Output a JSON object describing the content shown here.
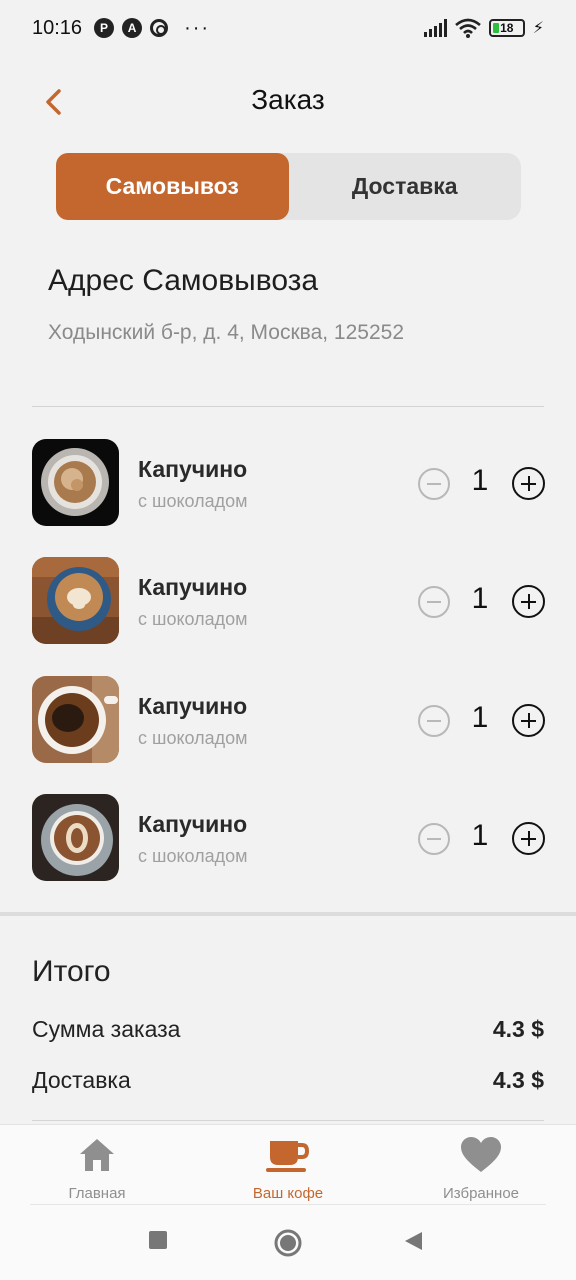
{
  "status_bar": {
    "time": "10:16",
    "icons": [
      "p-app-icon",
      "a-app-icon",
      "spiral-icon",
      "more-dots-icon"
    ],
    "dots": "···",
    "battery_level": "18",
    "right_icons": [
      "signal-icon",
      "wifi-icon",
      "battery-icon",
      "charging-icon"
    ]
  },
  "header": {
    "title": "Заказ",
    "back_icon": "chevron-left-icon"
  },
  "tabs": [
    {
      "label": "Самовывоз",
      "active": true
    },
    {
      "label": "Доставка",
      "active": false
    }
  ],
  "pickup": {
    "title": "Адрес Самовывоза",
    "address": "Ходынский б-р, д. 4, Москва, 125252"
  },
  "items": [
    {
      "name": "Капучино",
      "subtitle": "с шоколадом",
      "quantity": "1",
      "image": "coffee-cup-top-view-black-bg"
    },
    {
      "name": "Капучино",
      "subtitle": "с шоколадом",
      "quantity": "1",
      "image": "latte-art-blue-cup"
    },
    {
      "name": "Капучино",
      "subtitle": "с шоколадом",
      "quantity": "1",
      "image": "coffee-white-cup"
    },
    {
      "name": "Капучино",
      "subtitle": "с шоколадом",
      "quantity": "1",
      "image": "latte-art-dark"
    }
  ],
  "totals": {
    "title": "Итого",
    "rows": [
      {
        "label": "Сумма заказа",
        "value": "4.3 $"
      },
      {
        "label": "Доставка",
        "value": "4.3 $"
      }
    ]
  },
  "bottom_nav": [
    {
      "label": "Главная",
      "icon": "home-icon",
      "active": false
    },
    {
      "label": "Ваш кофе",
      "icon": "coffee-cup-icon",
      "active": true
    },
    {
      "label": "Избранное",
      "icon": "heart-icon",
      "active": false
    }
  ],
  "colors": {
    "accent": "#c4672f",
    "background": "#f2f2f2",
    "muted_text": "#8a8a8a"
  }
}
